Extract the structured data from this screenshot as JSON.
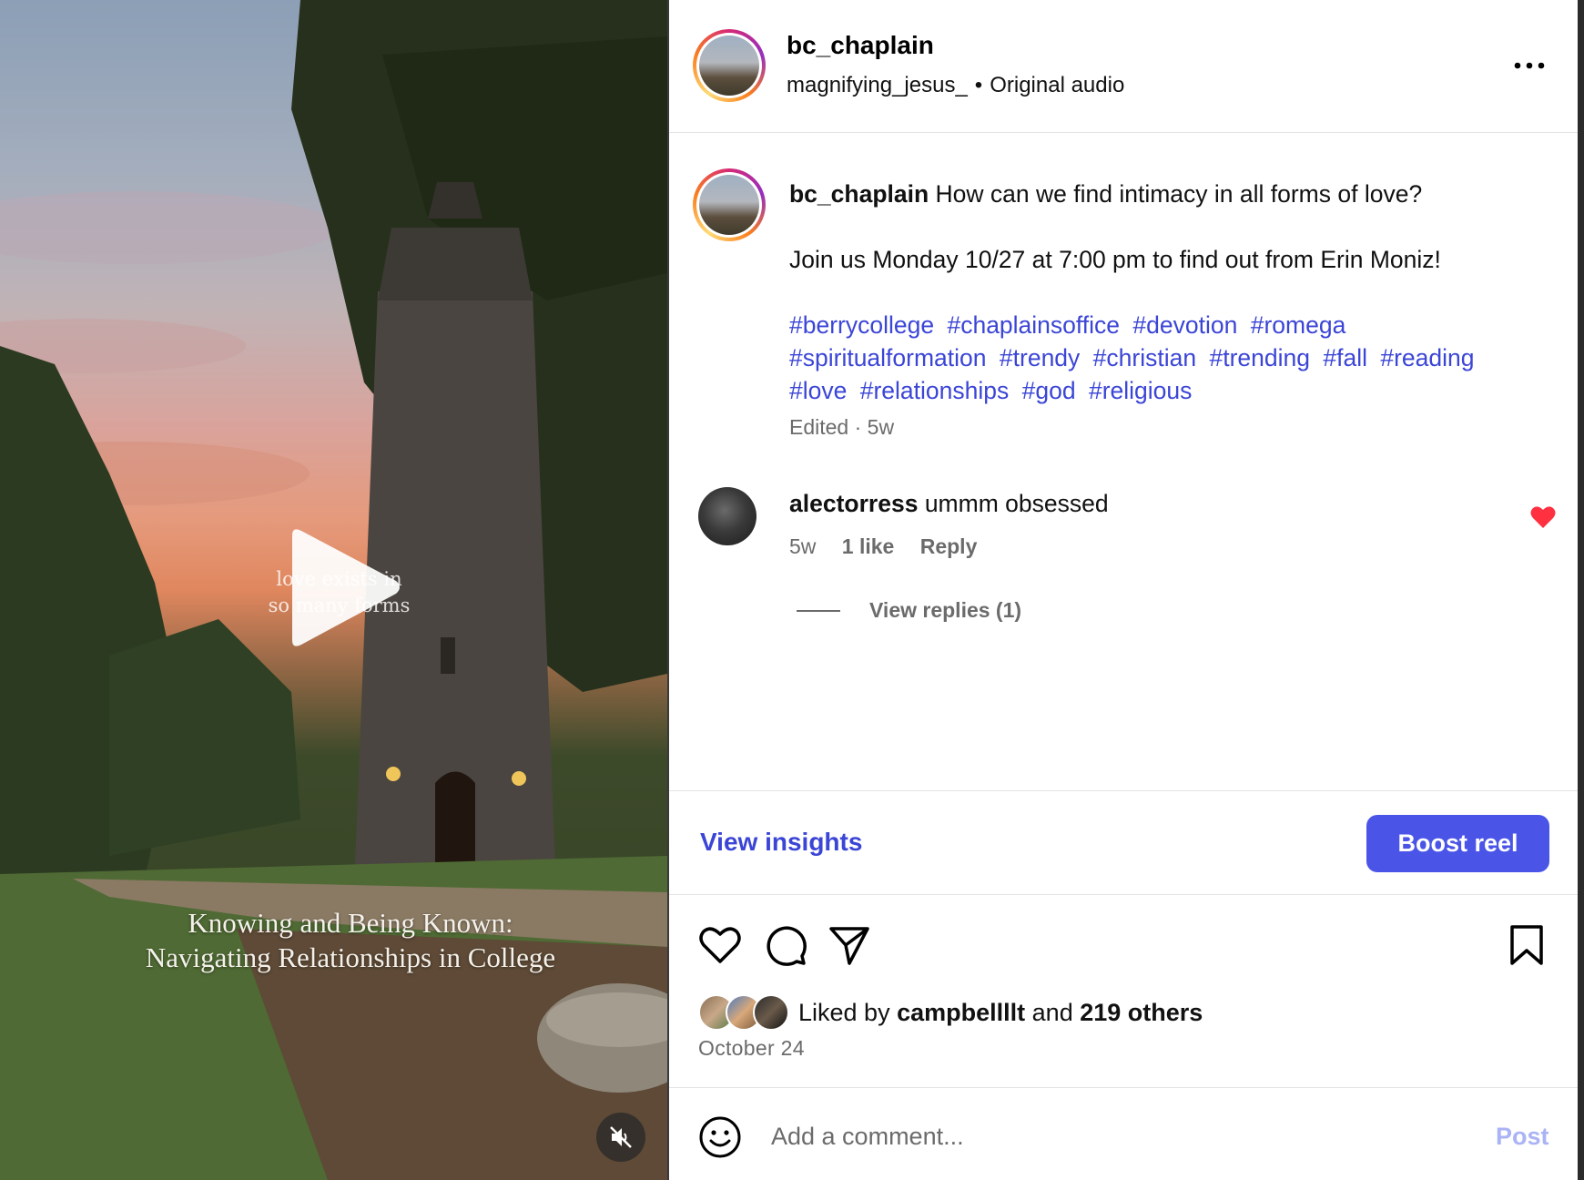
{
  "post": {
    "username": "bc_chaplain",
    "audio_user": "magnifying_jesus_",
    "audio_separator": "•",
    "audio_label": "Original audio"
  },
  "video": {
    "overlay_small_line1": "love exists in",
    "overlay_small_line2": "so many forms",
    "overlay_title_line1": "Knowing and Being Known:",
    "overlay_title_line2": "Navigating Relationships in College"
  },
  "caption": {
    "username": "bc_chaplain",
    "text": "How can we find intimacy in all forms of love?",
    "line2": "Join us Monday 10/27 at 7:00 pm to find out from Erin Moniz!",
    "hashtags": [
      "#berrycollege",
      "#chaplainsoffice",
      "#devotion",
      "#romega",
      "#spiritualformation",
      "#trendy",
      "#christian",
      "#trending",
      "#fall",
      "#reading",
      "#love",
      "#relationships",
      "#god",
      "#religious"
    ],
    "edited": "Edited · 5w"
  },
  "comment": {
    "username": "alectorress",
    "text": "ummm obsessed",
    "time": "5w",
    "likes": "1 like",
    "reply": "Reply",
    "view_replies": "View replies (1)"
  },
  "insights": {
    "view_label": "View insights",
    "boost_label": "Boost reel"
  },
  "likes": {
    "prefix": "Liked by",
    "user": "campbellllt",
    "and": "and",
    "others": "219 others"
  },
  "date": "October 24",
  "comment_box": {
    "placeholder": "Add a comment...",
    "post_label": "Post"
  },
  "colors": {
    "accent": "#4a55e8",
    "hashtag": "#3b45d6",
    "like_red": "#ff3040",
    "muted": "#6b6b6b"
  },
  "icons": [
    "play-icon",
    "mute-icon",
    "more-icon",
    "heart-icon",
    "comment-icon",
    "share-icon",
    "bookmark-icon",
    "emoji-icon"
  ]
}
